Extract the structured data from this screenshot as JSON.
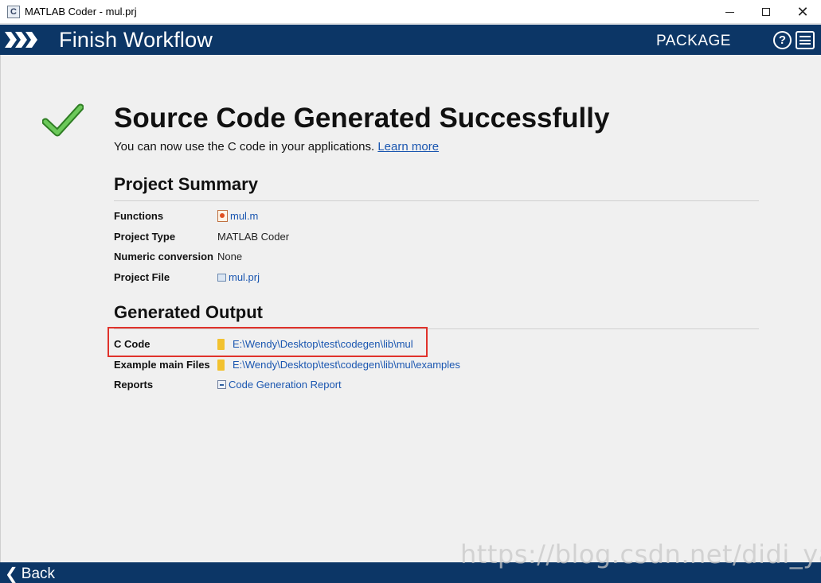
{
  "window": {
    "title": "MATLAB Coder - mul.prj"
  },
  "header": {
    "title": "Finish Workflow",
    "package_label": "PACKAGE",
    "help_glyph": "?"
  },
  "main": {
    "heading": "Source Code Generated Successfully",
    "subtitle": "You can now use the C code in your applications.",
    "learn_more": "Learn more",
    "summary": {
      "title": "Project Summary",
      "rows": [
        {
          "label": "Functions",
          "value": "mul.m",
          "icon": "matlab-file-icon"
        },
        {
          "label": "Project Type",
          "value": "MATLAB Coder",
          "icon": ""
        },
        {
          "label": "Numeric conversion",
          "value": "None",
          "icon": ""
        },
        {
          "label": "Project File",
          "value": "mul.prj",
          "icon": "project-file-icon"
        }
      ]
    },
    "output": {
      "title": "Generated Output",
      "rows": [
        {
          "label": "C Code",
          "value": "E:\\Wendy\\Desktop\\test\\codegen\\lib\\mul",
          "icon": "folder-icon"
        },
        {
          "label": "Example main Files",
          "value": "E:\\Wendy\\Desktop\\test\\codegen\\lib\\mul\\examples",
          "icon": "folder-icon"
        },
        {
          "label": "Reports",
          "value": "Code Generation Report",
          "icon": "report-icon"
        }
      ]
    }
  },
  "footer": {
    "back_label": "Back",
    "back_glyph": "❮"
  },
  "watermark": "https://blog.csdn.net/didi_ya",
  "colors": {
    "header_bg": "#0c3666",
    "link": "#1a56b0",
    "highlight": "#e0322b",
    "check_green": "#4caf3a"
  }
}
